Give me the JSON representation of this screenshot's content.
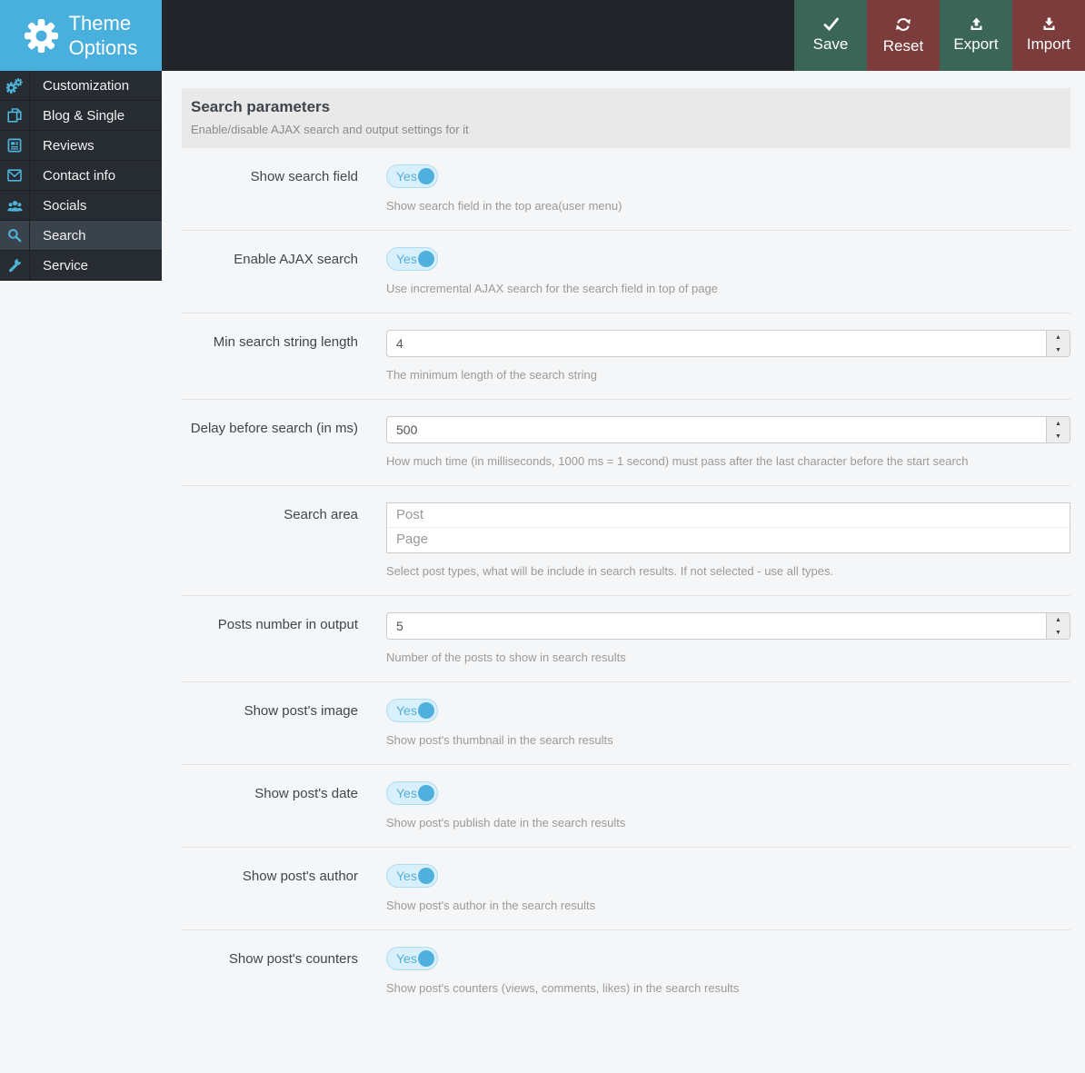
{
  "header": {
    "logo": {
      "line1": "Theme",
      "line2": "Options"
    },
    "actions": [
      {
        "label": "Save",
        "icon": "check-icon"
      },
      {
        "label": "Reset",
        "icon": "refresh-icon"
      },
      {
        "label": "Export",
        "icon": "upload-icon"
      },
      {
        "label": "Import",
        "icon": "download-icon"
      }
    ]
  },
  "sidebar": {
    "items": [
      {
        "label": "Customization",
        "icon": "cogs-icon"
      },
      {
        "label": "Blog & Single",
        "icon": "copy-icon"
      },
      {
        "label": "Reviews",
        "icon": "newspaper-icon"
      },
      {
        "label": "Contact info",
        "icon": "envelope-icon"
      },
      {
        "label": "Socials",
        "icon": "users-icon"
      },
      {
        "label": "Search",
        "icon": "search-icon",
        "active": true
      },
      {
        "label": "Service",
        "icon": "wrench-icon"
      }
    ]
  },
  "section": {
    "title": "Search parameters",
    "subtitle": "Enable/disable AJAX search and output settings for it"
  },
  "rows": [
    {
      "type": "toggle",
      "label": "Show search field",
      "value": "Yes",
      "help": "Show search field in the top area(user menu)"
    },
    {
      "type": "toggle",
      "label": "Enable AJAX search",
      "value": "Yes",
      "help": "Use incremental AJAX search for the search field in top of page"
    },
    {
      "type": "number",
      "label": "Min search string length",
      "value": "4",
      "help": "The minimum length of the search string"
    },
    {
      "type": "number",
      "label": "Delay before search (in ms)",
      "value": "500",
      "help": "How much time (in milliseconds, 1000 ms = 1 second) must pass after the last character before the start search"
    },
    {
      "type": "multiselect",
      "label": "Search area",
      "options": [
        "Post",
        "Page"
      ],
      "help": "Select post types, what will be include in search results. If not selected - use all types."
    },
    {
      "type": "number",
      "label": "Posts number in output",
      "value": "5",
      "help": "Number of the posts to show in search results"
    },
    {
      "type": "toggle",
      "label": "Show post's image",
      "value": "Yes",
      "help": "Show post's thumbnail in the search results"
    },
    {
      "type": "toggle",
      "label": "Show post's date",
      "value": "Yes",
      "help": "Show post's publish date in the search results"
    },
    {
      "type": "toggle",
      "label": "Show post's author",
      "value": "Yes",
      "help": "Show post's author in the search results"
    },
    {
      "type": "toggle",
      "label": "Show post's counters",
      "value": "Yes",
      "help": "Show post's counters (views, comments, likes) in the search results"
    }
  ],
  "icons": {
    "spin_up": "▲",
    "spin_down": "▼"
  },
  "colors": {
    "topbar_dark": "#222529",
    "logo_blue": "#49b0dd",
    "sidebar_bg": "#272c33",
    "sidebar_active": "#3a424c",
    "sidebar_icon_blue": "#4db3d9",
    "button_green": "#3a6557",
    "button_red": "#7b3c3b",
    "toggle_bg": "#d7f0fb",
    "toggle_knob": "#4fb0de",
    "section_head_bg": "#e9e9e9"
  }
}
